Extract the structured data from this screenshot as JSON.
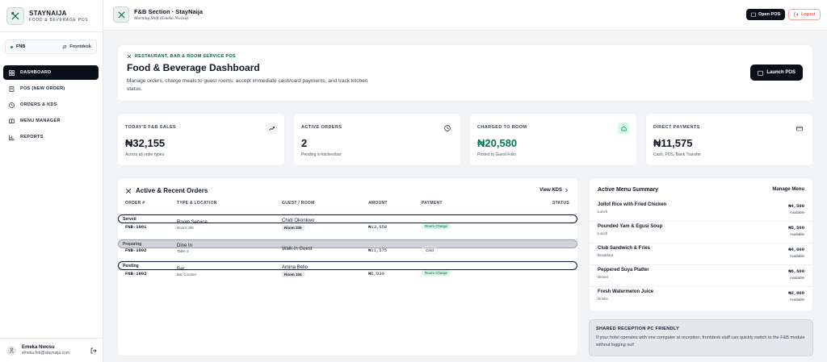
{
  "brand": {
    "name": "STAYNAIJA",
    "subtitle": "FOOD & BEVERAGE POS"
  },
  "mode": {
    "active": "FNB",
    "switch_label": "Frontdesk"
  },
  "nav": [
    {
      "label": "DASHBOARD",
      "icon": "grid-icon"
    },
    {
      "label": "POS (NEW ORDER)",
      "icon": "receipt-icon"
    },
    {
      "label": "ORDERS & KDS",
      "icon": "clock-icon"
    },
    {
      "label": "MENU MANAGER",
      "icon": "book-icon"
    },
    {
      "label": "REPORTS",
      "icon": "bar-chart-icon"
    }
  ],
  "user": {
    "name": "Emeka Nwosu",
    "email": "emeka.fnb@staynaija.com"
  },
  "topbar": {
    "title": "F&B Section · StayNaija",
    "subtitle": "Morning Shift (Emeka Nwosu)",
    "open_pos": "Open POS",
    "logout": "Logout"
  },
  "hero": {
    "eyebrow": "RESTAURANT, BAR & ROOM SERVICE POS",
    "title": "Food & Beverage Dashboard",
    "description": "Manage orders, charge meals to guest rooms, accept immediate cash/card payments, and track kitchen status.",
    "launch": "Launch POS"
  },
  "stats": [
    {
      "label": "TODAY'S F&B SALES",
      "value": "₦32,155",
      "note": "Across all order types",
      "icon": "trending-up-icon"
    },
    {
      "label": "ACTIVE ORDERS",
      "value": "2",
      "note": "Pending in kitchen/bar",
      "icon": "clock-icon"
    },
    {
      "label": "CHARGED TO ROOM",
      "value": "₦20,580",
      "note": "Posted to Guest Folio",
      "icon": "room-icon"
    },
    {
      "label": "DIRECT PAYMENTS",
      "value": "₦11,575",
      "note": "Cash, POS, Bank Transfer",
      "icon": "card-icon"
    }
  ],
  "orders": {
    "title": "Active & Recent Orders",
    "view_link": "View KDS",
    "columns": [
      "ORDER #",
      "TYPE & LOCATION",
      "GUEST / ROOM",
      "AMOUNT",
      "PAYMENT",
      "STATUS"
    ],
    "rows": [
      {
        "id": "FNB-1001",
        "type": "Room Service",
        "location": "Room 205",
        "guest": "Chidi Okonkwo",
        "room": "Room 205",
        "amount": "₦13,650",
        "payment": "Room Charge",
        "status": "Served"
      },
      {
        "id": "FNB-1002",
        "type": "Dine In",
        "location": "Table 3",
        "guest": "Walk-in Guest",
        "room": "",
        "amount": "₦11,575",
        "payment": "Card",
        "status": "Preparing"
      },
      {
        "id": "FNB-1003",
        "type": "Bar",
        "location": "Bar Counter",
        "guest": "Amina Bello",
        "room": "Room 104",
        "amount": "₦6,930",
        "payment": "Room Charge",
        "status": "Pending"
      }
    ]
  },
  "menu": {
    "title": "Active Menu Summary",
    "manage": "Manage Menu",
    "items": [
      {
        "name": "Jollof Rice with Fried Chicken",
        "category": "Lunch",
        "price": "₦4,500",
        "availability": "Available"
      },
      {
        "name": "Pounded Yam & Egusi Soup",
        "category": "Lunch",
        "price": "₦5,500",
        "availability": "Available"
      },
      {
        "name": "Club Sandwich & Fries",
        "category": "Breakfast",
        "price": "₦4,000",
        "availability": "Available"
      },
      {
        "name": "Peppered Suya Platter",
        "category": "Dinner",
        "price": "₦6,500",
        "availability": "Available"
      },
      {
        "name": "Fresh Watermelon Juice",
        "category": "Drinks",
        "price": "₦2,000",
        "availability": "Available"
      }
    ]
  },
  "shared": {
    "title": "SHARED RECEPTION PC FRIENDLY",
    "description": "If your hotel operates with one computer at reception, frontdesk staff can quickly switch to the F&B module without logging out!"
  },
  "colors": {
    "dark": "#0b0f19",
    "green": "#047857",
    "danger": "#dc2626"
  }
}
